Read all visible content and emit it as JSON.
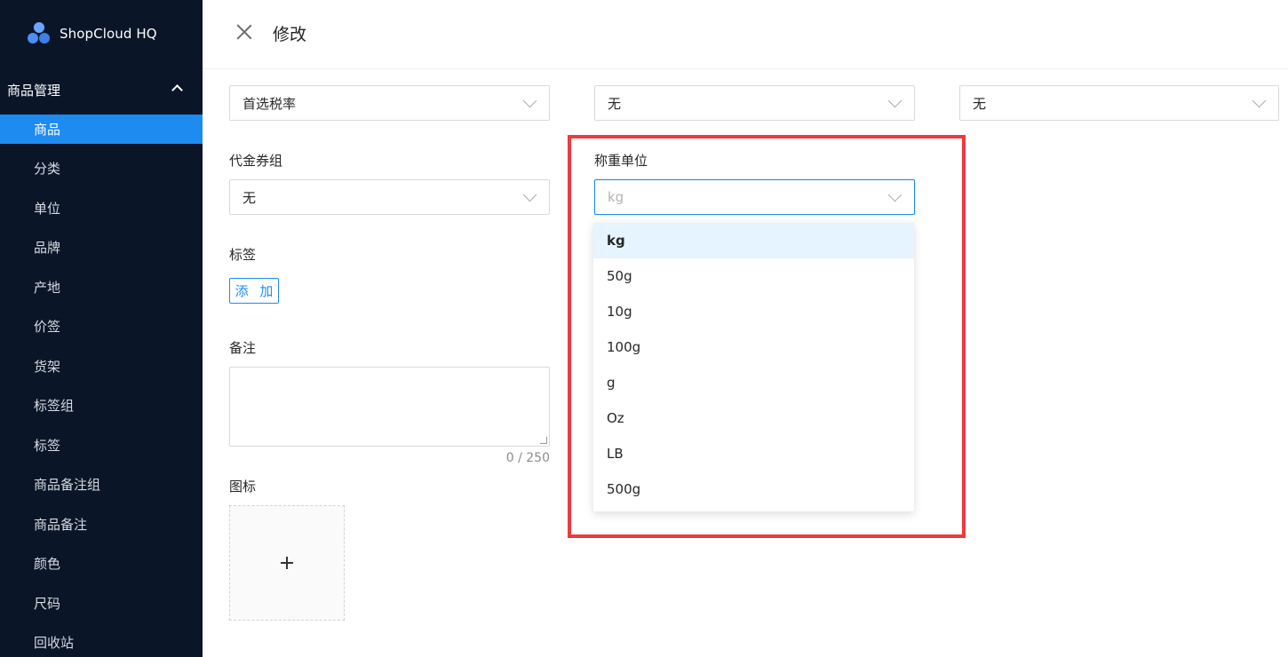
{
  "sidebar": {
    "brand": "ShopCloud HQ",
    "group": "商品管理",
    "items": [
      "商品",
      "分类",
      "单位",
      "品牌",
      "产地",
      "价签",
      "货架",
      "标签组",
      "标签",
      "商品备注组",
      "商品备注",
      "颜色",
      "尺码",
      "回收站"
    ],
    "active_index": 0,
    "colors": {
      "background": "#0b1528",
      "active": "#1e8bf0"
    }
  },
  "header": {
    "title": "修改"
  },
  "form": {
    "row1": [
      {
        "value": "首选税率"
      },
      {
        "value": "无"
      },
      {
        "value": "无"
      }
    ],
    "voucher_group": {
      "label": "代金券组",
      "value": "无"
    },
    "weight_unit": {
      "label": "称重单位",
      "placeholder": "kg"
    },
    "tags": {
      "label": "标签",
      "add_button": "添 加"
    },
    "remark": {
      "label": "备注",
      "counter": "0 / 250"
    },
    "icon": {
      "label": "图标"
    }
  },
  "dropdown": {
    "options": [
      "kg",
      "50g",
      "10g",
      "100g",
      "g",
      "Oz",
      "LB",
      "500g"
    ],
    "selected": "kg"
  },
  "accent": "#1e8bf0",
  "highlight_color": "#ee3a3e"
}
